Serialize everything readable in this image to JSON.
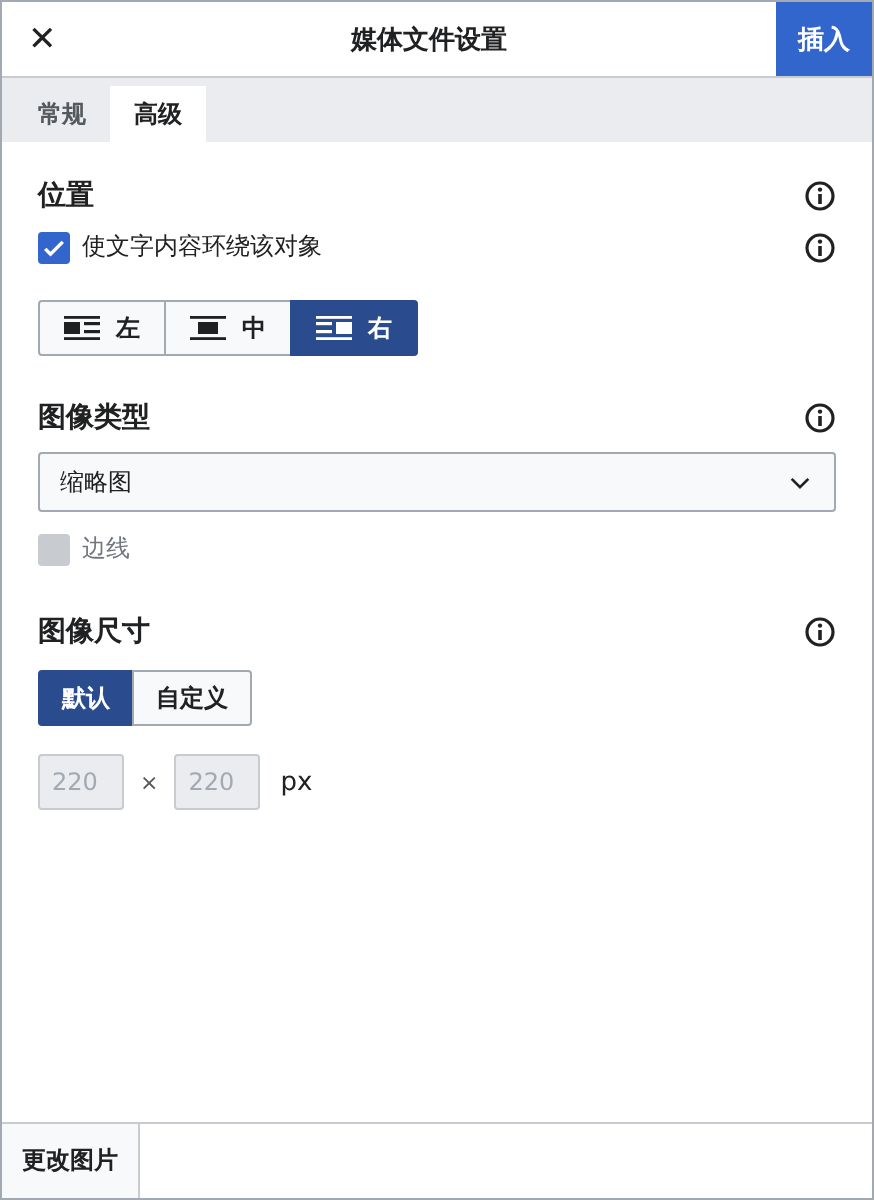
{
  "window": {
    "title": "媒体文件设置",
    "close_label": "✕",
    "primary_button": "插入"
  },
  "tabs": [
    {
      "label": "常规",
      "selected": false
    },
    {
      "label": "高级",
      "selected": true
    }
  ],
  "position": {
    "heading": "位置",
    "wrap": {
      "label": "使文字内容环绕该对象",
      "checked": true
    },
    "alignments": [
      {
        "label": "左",
        "kind": "left",
        "selected": false
      },
      {
        "label": "中",
        "kind": "center",
        "selected": false
      },
      {
        "label": "右",
        "kind": "right",
        "selected": true
      }
    ]
  },
  "image_type": {
    "heading": "图像类型",
    "dropdown": {
      "value": "缩略图"
    },
    "border": {
      "label": "边线",
      "checked": false,
      "disabled": true
    }
  },
  "image_size": {
    "heading": "图像尺寸",
    "modes": [
      {
        "label": "默认",
        "selected": true
      },
      {
        "label": "自定义",
        "selected": false
      }
    ],
    "width": {
      "placeholder": "220",
      "disabled": true
    },
    "times": "×",
    "height": {
      "placeholder": "220",
      "disabled": true
    },
    "unit": "px"
  },
  "footer": {
    "button": "更改图片"
  }
}
